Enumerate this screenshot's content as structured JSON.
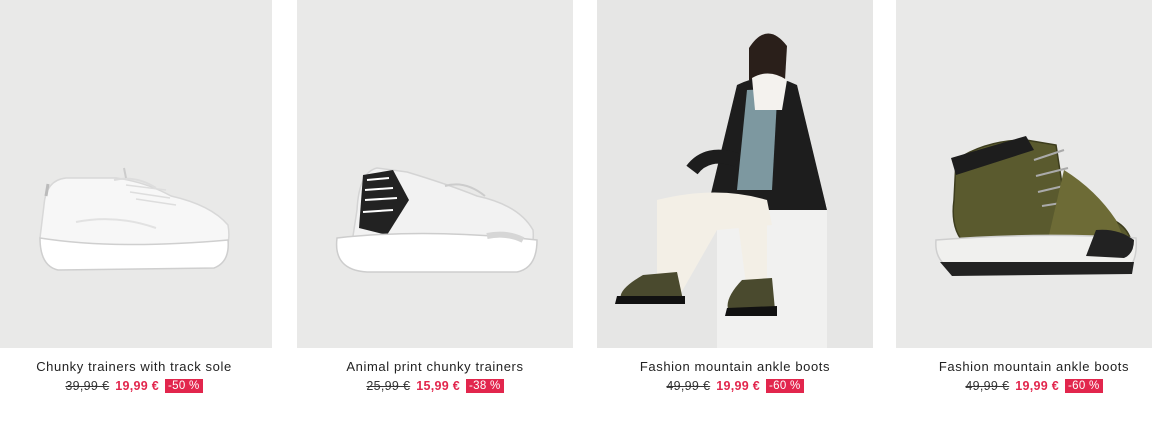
{
  "products": [
    {
      "title": "Chunky trainers with track sole",
      "old_price": "39,99 €",
      "new_price": "19,99 €",
      "discount": "-50 %",
      "image": "white-chunky-trainer"
    },
    {
      "title": "Animal print chunky trainers",
      "old_price": "25,99 €",
      "new_price": "15,99 €",
      "discount": "-38 %",
      "image": "animal-print-trainer"
    },
    {
      "title": "Fashion mountain ankle boots",
      "old_price": "49,99 €",
      "new_price": "19,99 €",
      "discount": "-60 %",
      "image": "model-wearing-boots"
    },
    {
      "title": "Fashion mountain ankle boots",
      "old_price": "49,99 €",
      "new_price": "19,99 €",
      "discount": "-60 %",
      "image": "khaki-mountain-boot"
    }
  ],
  "colors": {
    "sale": "#e2264d",
    "image_bg": "#e9e9e8"
  }
}
